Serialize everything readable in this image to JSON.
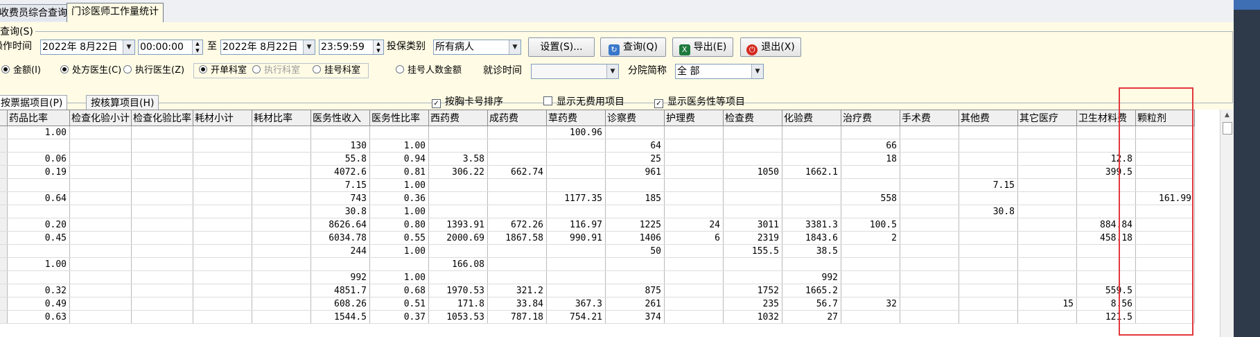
{
  "tabs": [
    {
      "label": "收费员综合查询"
    },
    {
      "label": "门诊医师工作量统计"
    }
  ],
  "query": {
    "legend": "查询(S)",
    "op_time_label": "操作时间",
    "date_from": "2022年 8月22日",
    "time_from": "00:00:00",
    "to_label": "至",
    "date_to": "2022年 8月22日",
    "time_to": "23:59:59",
    "insure_label": "投保类别",
    "insure_value": "所有病人",
    "btn_settings": "设置(S)...",
    "btn_query": "查询(Q)",
    "btn_export": "导出(E)",
    "btn_exit": "退出(X)",
    "radios_amount": [
      "金额(I)",
      "处方医生(C)",
      "执行医生(Z)"
    ],
    "radios_dept": [
      "开单科室",
      "执行科室",
      "挂号科室"
    ],
    "radio_reg": "挂号人数金额",
    "visit_time_label": "就诊时间",
    "visit_time_value": "",
    "branch_label": "分院简称",
    "branch_value": "全 部",
    "subtabs": [
      "按票据项目(P)",
      "按核算项目(H)"
    ],
    "checks": [
      {
        "label": "按胸卡号排序",
        "checked": true
      },
      {
        "label": "显示无费用项目",
        "checked": false
      },
      {
        "label": "显示医务性等项目",
        "checked": true
      }
    ]
  },
  "table": {
    "columns": [
      "药品比率",
      "检查化验小计",
      "检查化验比率",
      "耗材小计",
      "耗材比率",
      "医务性收入",
      "医务性比率",
      "西药费",
      "成药费",
      "草药费",
      "诊察费",
      "护理费",
      "检查费",
      "化验费",
      "治疗费",
      "手术费",
      "其他费",
      "其它医疗",
      "卫生材料费",
      "颗粒剂"
    ],
    "rows": [
      [
        "1.00",
        "",
        "",
        "",
        "",
        "",
        "",
        "",
        "",
        "100.96",
        "",
        "",
        "",
        "",
        "",
        "",
        "",
        "",
        "",
        ""
      ],
      [
        "",
        "",
        "",
        "",
        "",
        "130",
        "1.00",
        "",
        "",
        "",
        "64",
        "",
        "",
        "",
        "66",
        "",
        "",
        "",
        "",
        ""
      ],
      [
        "0.06",
        "",
        "",
        "",
        "",
        "55.8",
        "0.94",
        "3.58",
        "",
        "",
        "25",
        "",
        "",
        "",
        "18",
        "",
        "",
        "",
        "12.8",
        ""
      ],
      [
        "0.19",
        "",
        "",
        "",
        "",
        "4072.6",
        "0.81",
        "306.22",
        "662.74",
        "",
        "961",
        "",
        "1050",
        "1662.1",
        "",
        "",
        "",
        "",
        "399.5",
        ""
      ],
      [
        "",
        "",
        "",
        "",
        "",
        "7.15",
        "1.00",
        "",
        "",
        "",
        "",
        "",
        "",
        "",
        "",
        "",
        "7.15",
        "",
        "",
        ""
      ],
      [
        "0.64",
        "",
        "",
        "",
        "",
        "743",
        "0.36",
        "",
        "",
        "1177.35",
        "185",
        "",
        "",
        "",
        "558",
        "",
        "",
        "",
        "",
        "161.99"
      ],
      [
        "",
        "",
        "",
        "",
        "",
        "30.8",
        "1.00",
        "",
        "",
        "",
        "",
        "",
        "",
        "",
        "",
        "",
        "30.8",
        "",
        "",
        ""
      ],
      [
        "0.20",
        "",
        "",
        "",
        "",
        "8626.64",
        "0.80",
        "1393.91",
        "672.26",
        "116.97",
        "1225",
        "24",
        "3011",
        "3381.3",
        "100.5",
        "",
        "",
        "",
        "884.84",
        ""
      ],
      [
        "0.45",
        "",
        "",
        "",
        "",
        "6034.78",
        "0.55",
        "2000.69",
        "1867.58",
        "990.91",
        "1406",
        "6",
        "2319",
        "1843.6",
        "2",
        "",
        "",
        "",
        "458.18",
        ""
      ],
      [
        "",
        "",
        "",
        "",
        "",
        "244",
        "1.00",
        "",
        "",
        "",
        "50",
        "",
        "155.5",
        "38.5",
        "",
        "",
        "",
        "",
        "",
        ""
      ],
      [
        "1.00",
        "",
        "",
        "",
        "",
        "",
        "",
        "166.08",
        "",
        "",
        "",
        "",
        "",
        "",
        "",
        "",
        "",
        "",
        "",
        ""
      ],
      [
        "",
        "",
        "",
        "",
        "",
        "992",
        "1.00",
        "",
        "",
        "",
        "",
        "",
        "",
        "992",
        "",
        "",
        "",
        "",
        "",
        ""
      ],
      [
        "0.32",
        "",
        "",
        "",
        "",
        "4851.7",
        "0.68",
        "1970.53",
        "321.2",
        "",
        "875",
        "",
        "1752",
        "1665.2",
        "",
        "",
        "",
        "",
        "559.5",
        ""
      ],
      [
        "0.49",
        "",
        "",
        "",
        "",
        "608.26",
        "0.51",
        "171.8",
        "33.84",
        "367.3",
        "261",
        "",
        "235",
        "56.7",
        "32",
        "",
        "",
        "15",
        "8.56",
        ""
      ],
      [
        "0.63",
        "",
        "",
        "",
        "",
        "1544.5",
        "0.37",
        "1053.53",
        "787.18",
        "754.21",
        "374",
        "",
        "1032",
        "27",
        "",
        "",
        "",
        "",
        "121.5",
        ""
      ]
    ]
  }
}
